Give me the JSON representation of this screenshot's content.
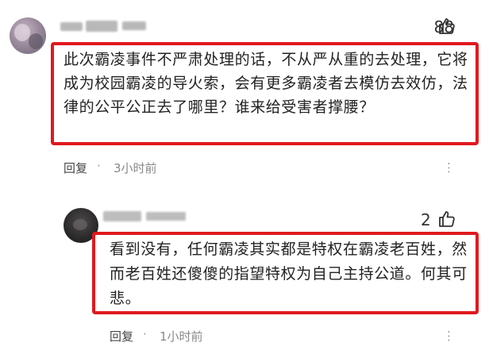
{
  "accent_color": "#e0191e",
  "comments": [
    {
      "author_blurred": true,
      "likes": "88",
      "like_icon": "thumbs-up-icon",
      "body": "此次霸凌事件不严肃处理的话，不从严从重的去处理，它将成为校园霸凌的导火索，会有更多霸凌者去模仿去效仿，法律的公平公正去了哪里？谁来给受害者撑腰？",
      "reply_label": "回复",
      "separator": "·",
      "time": "3小时前",
      "more_icon": "more-options-icon",
      "more_label": "⋮"
    },
    {
      "author_blurred": true,
      "likes": "2",
      "like_icon": "thumbs-up-icon",
      "body": "看到没有，任何霸凌其实都是特权在霸凌老百姓，然而老百姓还傻傻的指望特权为自己主持公道。何其可悲。",
      "reply_label": "回复",
      "separator": "·",
      "time": "1小时前",
      "more_icon": "more-options-icon",
      "more_label": "⋮"
    }
  ]
}
